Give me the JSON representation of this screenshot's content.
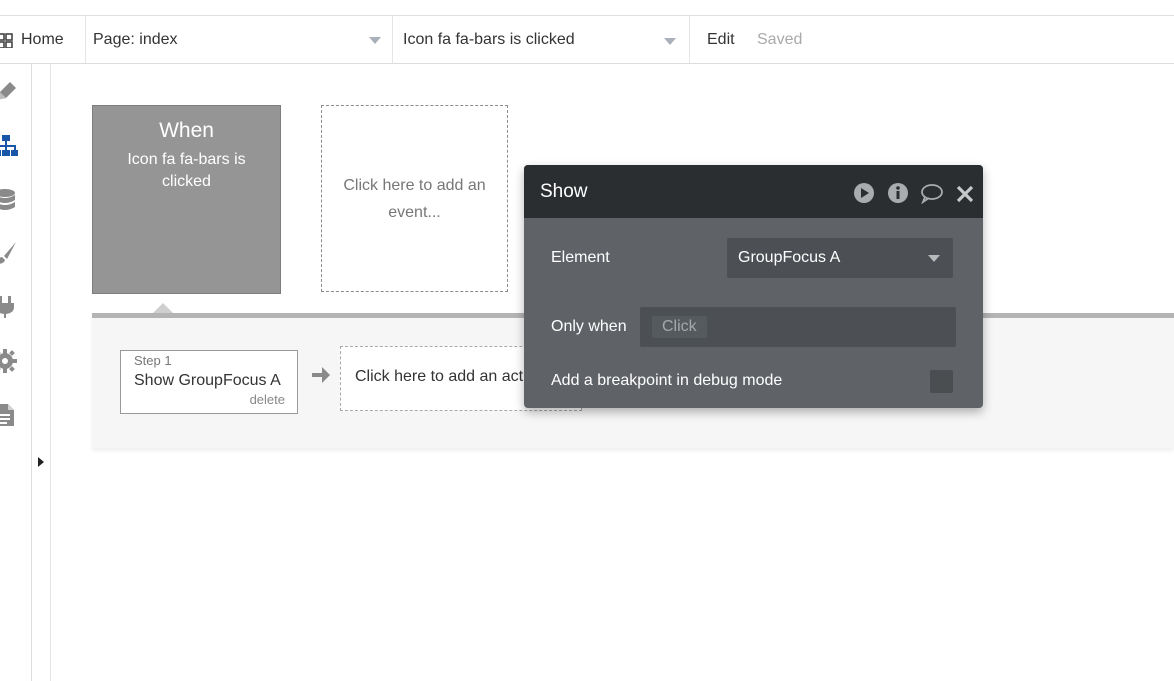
{
  "topbar": {
    "home_label": "Home",
    "page_selector": "Page: index",
    "event_selector": "Icon fa fa-bars is clicked",
    "edit_label": "Edit",
    "saved_label": "Saved"
  },
  "sidebar": {
    "icons": [
      "design-icon",
      "workflow-icon",
      "data-icon",
      "styles-icon",
      "plugins-icon",
      "settings-icon",
      "logs-icon"
    ]
  },
  "event": {
    "title": "When",
    "subtitle": "Icon fa fa-bars is clicked",
    "add_event_label": "Click here to add an event..."
  },
  "step": {
    "number_label": "Step 1",
    "title": "Show GroupFocus A",
    "delete_label": "delete"
  },
  "add_action_label": "Click here to add an action...",
  "popup": {
    "title": "Show",
    "element_label": "Element",
    "element_value": "GroupFocus A",
    "only_when_label": "Only when",
    "only_when_placeholder": "Click",
    "breakpoint_label": "Add a breakpoint in debug mode"
  },
  "colors": {
    "workflow_active": "#1a56a8",
    "popup_header": "#2b2e30",
    "popup_body": "#5f6368"
  }
}
